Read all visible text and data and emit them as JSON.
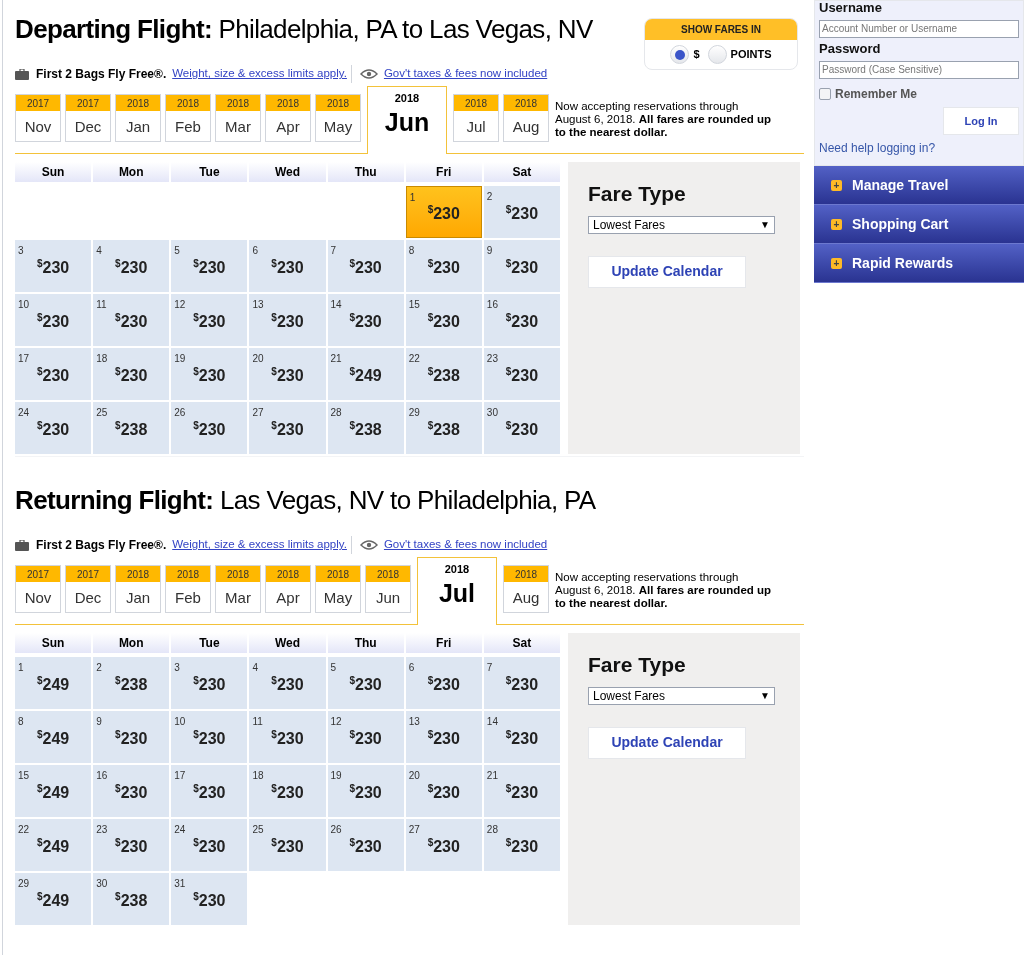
{
  "flights": [
    {
      "title_bold": "Departing Flight:",
      "title_rest": "Philadelphia, PA to Las Vegas, NV",
      "show_fares": {
        "label": "SHOW FARES IN",
        "options": [
          {
            "label": "$",
            "selected": true
          },
          {
            "label": "POINTS",
            "selected": false
          }
        ]
      },
      "bags": "First 2 Bags Fly Free®.",
      "limits_link": "Weight, size & excess limits apply.",
      "taxes_link": "Gov't taxes & fees now included",
      "months": [
        {
          "year": "2017",
          "month": "Nov",
          "selected": false
        },
        {
          "year": "2017",
          "month": "Dec",
          "selected": false
        },
        {
          "year": "2018",
          "month": "Jan",
          "selected": false
        },
        {
          "year": "2018",
          "month": "Feb",
          "selected": false
        },
        {
          "year": "2018",
          "month": "Mar",
          "selected": false
        },
        {
          "year": "2018",
          "month": "Apr",
          "selected": false
        },
        {
          "year": "2018",
          "month": "May",
          "selected": false
        },
        {
          "year": "2018",
          "month": "Jun",
          "selected": true
        },
        {
          "year": "2018",
          "month": "Jul",
          "selected": false
        },
        {
          "year": "2018",
          "month": "Aug",
          "selected": false
        }
      ],
      "note": "Now accepting reservations through August 6, 2018. **All fares are rounded up to the nearest dollar.**",
      "weekdays": [
        "Sun",
        "Mon",
        "Tue",
        "Wed",
        "Thu",
        "Fri",
        "Sat"
      ],
      "weeks": [
        [
          {
            "kind": "blank"
          },
          {
            "kind": "blank"
          },
          {
            "kind": "blank"
          },
          {
            "kind": "blank"
          },
          {
            "kind": "blank"
          },
          {
            "kind": "day",
            "day": "1",
            "currency": "$",
            "amount": "230",
            "selected": true
          },
          {
            "kind": "day",
            "day": "2",
            "currency": "$",
            "amount": "230",
            "selected": false
          }
        ],
        [
          {
            "kind": "day",
            "day": "3",
            "currency": "$",
            "amount": "230",
            "selected": false
          },
          {
            "kind": "day",
            "day": "4",
            "currency": "$",
            "amount": "230",
            "selected": false
          },
          {
            "kind": "day",
            "day": "5",
            "currency": "$",
            "amount": "230",
            "selected": false
          },
          {
            "kind": "day",
            "day": "6",
            "currency": "$",
            "amount": "230",
            "selected": false
          },
          {
            "kind": "day",
            "day": "7",
            "currency": "$",
            "amount": "230",
            "selected": false
          },
          {
            "kind": "day",
            "day": "8",
            "currency": "$",
            "amount": "230",
            "selected": false
          },
          {
            "kind": "day",
            "day": "9",
            "currency": "$",
            "amount": "230",
            "selected": false
          }
        ],
        [
          {
            "kind": "day",
            "day": "10",
            "currency": "$",
            "amount": "230",
            "selected": false
          },
          {
            "kind": "day",
            "day": "11",
            "currency": "$",
            "amount": "230",
            "selected": false
          },
          {
            "kind": "day",
            "day": "12",
            "currency": "$",
            "amount": "230",
            "selected": false
          },
          {
            "kind": "day",
            "day": "13",
            "currency": "$",
            "amount": "230",
            "selected": false
          },
          {
            "kind": "day",
            "day": "14",
            "currency": "$",
            "amount": "230",
            "selected": false
          },
          {
            "kind": "day",
            "day": "15",
            "currency": "$",
            "amount": "230",
            "selected": false
          },
          {
            "kind": "day",
            "day": "16",
            "currency": "$",
            "amount": "230",
            "selected": false
          }
        ],
        [
          {
            "kind": "day",
            "day": "17",
            "currency": "$",
            "amount": "230",
            "selected": false
          },
          {
            "kind": "day",
            "day": "18",
            "currency": "$",
            "amount": "230",
            "selected": false
          },
          {
            "kind": "day",
            "day": "19",
            "currency": "$",
            "amount": "230",
            "selected": false
          },
          {
            "kind": "day",
            "day": "20",
            "currency": "$",
            "amount": "230",
            "selected": false
          },
          {
            "kind": "day",
            "day": "21",
            "currency": "$",
            "amount": "249",
            "selected": false
          },
          {
            "kind": "day",
            "day": "22",
            "currency": "$",
            "amount": "238",
            "selected": false
          },
          {
            "kind": "day",
            "day": "23",
            "currency": "$",
            "amount": "230",
            "selected": false
          }
        ],
        [
          {
            "kind": "day",
            "day": "24",
            "currency": "$",
            "amount": "230",
            "selected": false
          },
          {
            "kind": "day",
            "day": "25",
            "currency": "$",
            "amount": "238",
            "selected": false
          },
          {
            "kind": "day",
            "day": "26",
            "currency": "$",
            "amount": "230",
            "selected": false
          },
          {
            "kind": "day",
            "day": "27",
            "currency": "$",
            "amount": "230",
            "selected": false
          },
          {
            "kind": "day",
            "day": "28",
            "currency": "$",
            "amount": "238",
            "selected": false
          },
          {
            "kind": "day",
            "day": "29",
            "currency": "$",
            "amount": "238",
            "selected": false
          },
          {
            "kind": "day",
            "day": "30",
            "currency": "$",
            "amount": "230",
            "selected": false
          }
        ]
      ],
      "fare_type": {
        "title": "Fare Type",
        "select": "Lowest Fares",
        "caret": "▼",
        "button": "Update Calendar"
      }
    },
    {
      "title_bold": "Returning Flight:",
      "title_rest": "Las Vegas, NV to Philadelphia, PA",
      "bags": "First 2 Bags Fly Free®.",
      "limits_link": "Weight, size & excess limits apply.",
      "taxes_link": "Gov't taxes & fees now included",
      "months": [
        {
          "year": "2017",
          "month": "Nov",
          "selected": false
        },
        {
          "year": "2017",
          "month": "Dec",
          "selected": false
        },
        {
          "year": "2018",
          "month": "Jan",
          "selected": false
        },
        {
          "year": "2018",
          "month": "Feb",
          "selected": false
        },
        {
          "year": "2018",
          "month": "Mar",
          "selected": false
        },
        {
          "year": "2018",
          "month": "Apr",
          "selected": false
        },
        {
          "year": "2018",
          "month": "May",
          "selected": false
        },
        {
          "year": "2018",
          "month": "Jun",
          "selected": false
        },
        {
          "year": "2018",
          "month": "Jul",
          "selected": true
        },
        {
          "year": "2018",
          "month": "Aug",
          "selected": false
        }
      ],
      "note": "Now accepting reservations through August 6, 2018. **All fares are rounded up to the nearest dollar.**",
      "weekdays": [
        "Sun",
        "Mon",
        "Tue",
        "Wed",
        "Thu",
        "Fri",
        "Sat"
      ],
      "weeks": [
        [
          {
            "kind": "day",
            "day": "1",
            "currency": "$",
            "amount": "249",
            "selected": false
          },
          {
            "kind": "day",
            "day": "2",
            "currency": "$",
            "amount": "238",
            "selected": false
          },
          {
            "kind": "day",
            "day": "3",
            "currency": "$",
            "amount": "230",
            "selected": false
          },
          {
            "kind": "day",
            "day": "4",
            "currency": "$",
            "amount": "230",
            "selected": false
          },
          {
            "kind": "day",
            "day": "5",
            "currency": "$",
            "amount": "230",
            "selected": false
          },
          {
            "kind": "day",
            "day": "6",
            "currency": "$",
            "amount": "230",
            "selected": false
          },
          {
            "kind": "day",
            "day": "7",
            "currency": "$",
            "amount": "230",
            "selected": false
          }
        ],
        [
          {
            "kind": "day",
            "day": "8",
            "currency": "$",
            "amount": "249",
            "selected": false
          },
          {
            "kind": "day",
            "day": "9",
            "currency": "$",
            "amount": "230",
            "selected": false
          },
          {
            "kind": "day",
            "day": "10",
            "currency": "$",
            "amount": "230",
            "selected": false
          },
          {
            "kind": "day",
            "day": "11",
            "currency": "$",
            "amount": "230",
            "selected": false
          },
          {
            "kind": "day",
            "day": "12",
            "currency": "$",
            "amount": "230",
            "selected": false
          },
          {
            "kind": "day",
            "day": "13",
            "currency": "$",
            "amount": "230",
            "selected": false
          },
          {
            "kind": "day",
            "day": "14",
            "currency": "$",
            "amount": "230",
            "selected": false
          }
        ],
        [
          {
            "kind": "day",
            "day": "15",
            "currency": "$",
            "amount": "249",
            "selected": false
          },
          {
            "kind": "day",
            "day": "16",
            "currency": "$",
            "amount": "230",
            "selected": false
          },
          {
            "kind": "day",
            "day": "17",
            "currency": "$",
            "amount": "230",
            "selected": false
          },
          {
            "kind": "day",
            "day": "18",
            "currency": "$",
            "amount": "230",
            "selected": false
          },
          {
            "kind": "day",
            "day": "19",
            "currency": "$",
            "amount": "230",
            "selected": false
          },
          {
            "kind": "day",
            "day": "20",
            "currency": "$",
            "amount": "230",
            "selected": false
          },
          {
            "kind": "day",
            "day": "21",
            "currency": "$",
            "amount": "230",
            "selected": false
          }
        ],
        [
          {
            "kind": "day",
            "day": "22",
            "currency": "$",
            "amount": "249",
            "selected": false
          },
          {
            "kind": "day",
            "day": "23",
            "currency": "$",
            "amount": "230",
            "selected": false
          },
          {
            "kind": "day",
            "day": "24",
            "currency": "$",
            "amount": "230",
            "selected": false
          },
          {
            "kind": "day",
            "day": "25",
            "currency": "$",
            "amount": "230",
            "selected": false
          },
          {
            "kind": "day",
            "day": "26",
            "currency": "$",
            "amount": "230",
            "selected": false
          },
          {
            "kind": "day",
            "day": "27",
            "currency": "$",
            "amount": "230",
            "selected": false
          },
          {
            "kind": "day",
            "day": "28",
            "currency": "$",
            "amount": "230",
            "selected": false
          }
        ],
        [
          {
            "kind": "day",
            "day": "29",
            "currency": "$",
            "amount": "249",
            "selected": false
          },
          {
            "kind": "day",
            "day": "30",
            "currency": "$",
            "amount": "238",
            "selected": false
          },
          {
            "kind": "day",
            "day": "31",
            "currency": "$",
            "amount": "230",
            "selected": false
          },
          {
            "kind": "blank"
          },
          {
            "kind": "blank"
          },
          {
            "kind": "blank"
          },
          {
            "kind": "blank"
          }
        ]
      ],
      "fare_type": {
        "title": "Fare Type",
        "select": "Lowest Fares",
        "caret": "▼",
        "button": "Update Calendar"
      }
    }
  ],
  "login": {
    "username_label": "Username",
    "username_placeholder": "Account Number or Username",
    "password_label": "Password",
    "password_placeholder": "Password (Case Sensitive)",
    "remember": {
      "label": "Remember Me",
      "checked": false
    },
    "button": "Log In",
    "help": "Need help logging in?"
  },
  "menu": [
    {
      "icon": "+",
      "label": "Manage Travel"
    },
    {
      "icon": "+",
      "label": "Shopping Cart"
    },
    {
      "icon": "+",
      "label": "Rapid Rewards"
    }
  ]
}
